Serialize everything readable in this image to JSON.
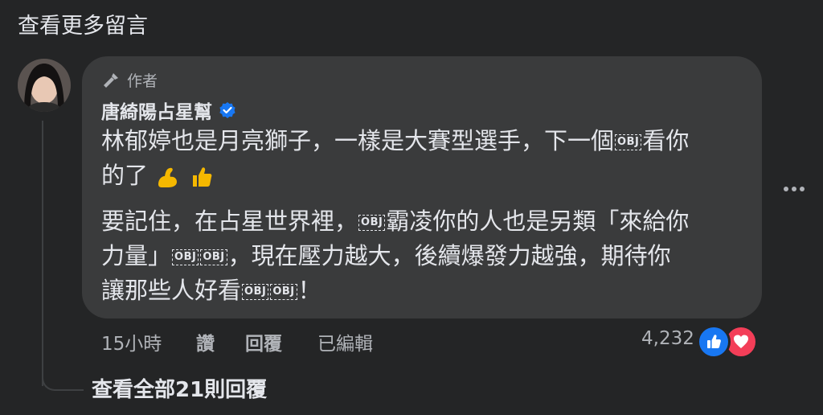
{
  "header": {
    "more_comments": "查看更多留言"
  },
  "comment": {
    "author_badge": "作者",
    "name": "唐綺陽占星幫",
    "line1a": "林郁婷也是月亮獅子，一樣是大賽型選手，下一個",
    "line1b": "看你",
    "line2": "的了",
    "obj_label": "OBJ",
    "para2a": "要記住，在占星世界裡，",
    "para2b": "霸凌你的人也是另類「來給你",
    "para2c": "力量」",
    "para2d": "，現在壓力越大，後續爆發力越強，期待你",
    "para2e": "讓那些人好看",
    "para2f": "！"
  },
  "actions": {
    "time": "15小時",
    "like": "讚",
    "reply": "回覆",
    "edited": "已編輯",
    "reaction_count": "4,232"
  },
  "replies": {
    "view_all": "查看全部21則回覆"
  },
  "colors": {
    "bg": "#242526",
    "bubble": "#3a3b3c",
    "like": "#1877f2",
    "love": "#f33e58",
    "verified": "#1877f2"
  }
}
